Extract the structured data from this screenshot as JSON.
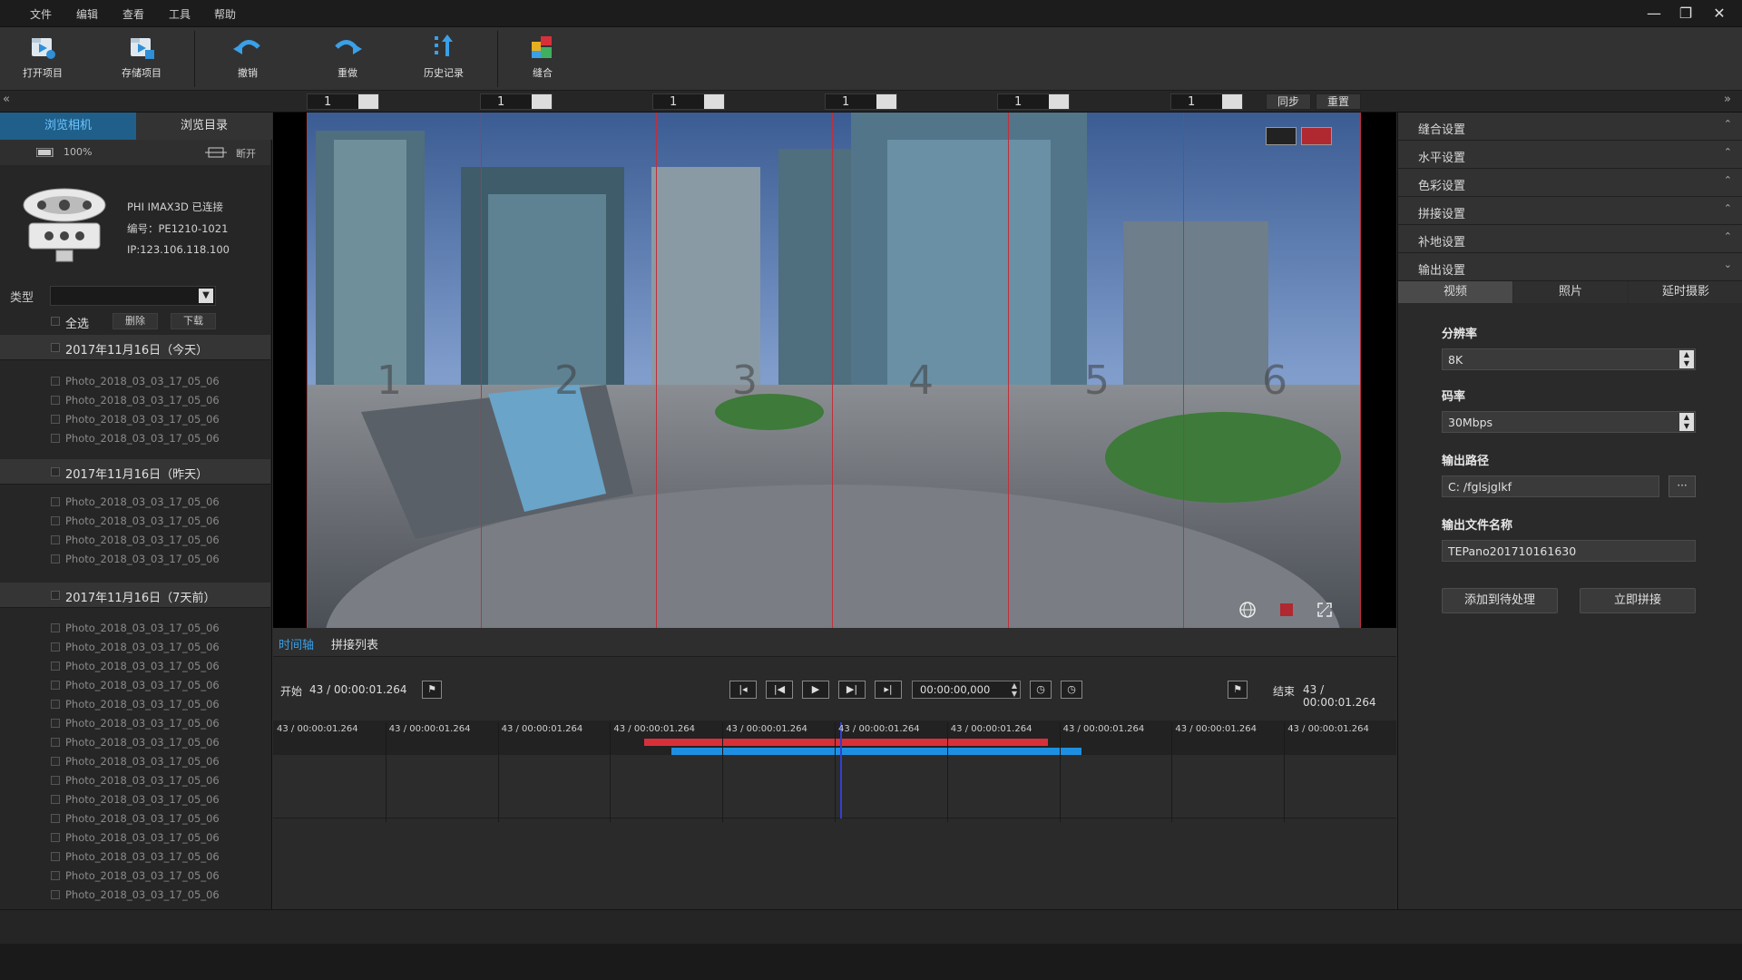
{
  "menu": [
    "文件",
    "编辑",
    "查看",
    "工具",
    "帮助"
  ],
  "window_controls": {
    "minimize": "—",
    "restore": "❐",
    "close": "✕"
  },
  "toolbar": {
    "open_project": "打开项目",
    "save_project": "存储项目",
    "undo": "撤销",
    "redo": "重做",
    "history": "历史记录",
    "stitch": "缝合"
  },
  "strip": {
    "spinners": [
      "1",
      "1",
      "1",
      "1",
      "1",
      "1"
    ],
    "sync_label": "同步",
    "reset_label": "重置",
    "left_arrow": "«",
    "right_arrow": "»"
  },
  "left": {
    "tab_camera": "浏览相机",
    "tab_dir": "浏览目录",
    "battery": "100%",
    "disconnect": "断开",
    "camera_name": "PHI IMAX3D 已连接",
    "camera_serial": "编号：PE1210-1021",
    "camera_ip": "IP:123.106.118.100",
    "type_label": "类型",
    "select_all": "全选",
    "delete": "删除",
    "download": "下载",
    "groups": [
      {
        "title": "2017年11月16日（今天）",
        "photos": [
          "Photo_2018_03_03_17_05_06",
          "Photo_2018_03_03_17_05_06",
          "Photo_2018_03_03_17_05_06",
          "Photo_2018_03_03_17_05_06"
        ]
      },
      {
        "title": "2017年11月16日（昨天）",
        "photos": [
          "Photo_2018_03_03_17_05_06",
          "Photo_2018_03_03_17_05_06",
          "Photo_2018_03_03_17_05_06",
          "Photo_2018_03_03_17_05_06"
        ]
      },
      {
        "title": "2017年11月16日（7天前）",
        "photos": [
          "Photo_2018_03_03_17_05_06",
          "Photo_2018_03_03_17_05_06",
          "Photo_2018_03_03_17_05_06",
          "Photo_2018_03_03_17_05_06",
          "Photo_2018_03_03_17_05_06",
          "Photo_2018_03_03_17_05_06",
          "Photo_2018_03_03_17_05_06",
          "Photo_2018_03_03_17_05_06",
          "Photo_2018_03_03_17_05_06",
          "Photo_2018_03_03_17_05_06",
          "Photo_2018_03_03_17_05_06",
          "Photo_2018_03_03_17_05_06",
          "Photo_2018_03_03_17_05_06",
          "Photo_2018_03_03_17_05_06",
          "Photo_2018_03_03_17_05_06"
        ]
      }
    ]
  },
  "viewer": {
    "segment_numbers": [
      "1",
      "2",
      "3",
      "4",
      "5",
      "6"
    ]
  },
  "timeline": {
    "tab_timeline": "时间轴",
    "tab_stitch_list": "拼接列表",
    "start_label": "开始",
    "start_value": "43 / 00:00:01.264",
    "end_label": "结束",
    "end_value": "43 / 00:00:01.264",
    "timecode": "00:00:00,000",
    "ticks": [
      "43 / 00:00:01.264",
      "43 / 00:00:01.264",
      "43 / 00:00:01.264",
      "43 / 00:00:01.264",
      "43 / 00:00:01.264",
      "43 / 00:00:01.264",
      "43 / 00:00:01.264",
      "43 / 00:00:01.264",
      "43 / 00:00:01.264",
      "43 / 00:00:01.264"
    ],
    "red_range": [
      0.33,
      0.69
    ],
    "blue_range": [
      0.355,
      0.72
    ],
    "playhead": 0.505
  },
  "right": {
    "sections": [
      "缝合设置",
      "水平设置",
      "色彩设置",
      "拼接设置",
      "补地设置",
      "输出设置"
    ],
    "tabs": [
      "视频",
      "照片",
      "延时摄影"
    ],
    "resolution_label": "分辨率",
    "resolution_value": "8K",
    "bitrate_label": "码率",
    "bitrate_value": "30Mbps",
    "path_label": "输出路径",
    "path_value": "C:  /fglsjglkf",
    "browse": "···",
    "filename_label": "输出文件名称",
    "filename_value": "TEPano201710161630",
    "add_queue": "添加到待处理",
    "stitch_now": "立即拼接"
  },
  "colors": {
    "accent": "#3aa0e8",
    "red": "#d8303a",
    "blue": "#1e8fe0",
    "active_tab": "#1f5f8a"
  }
}
